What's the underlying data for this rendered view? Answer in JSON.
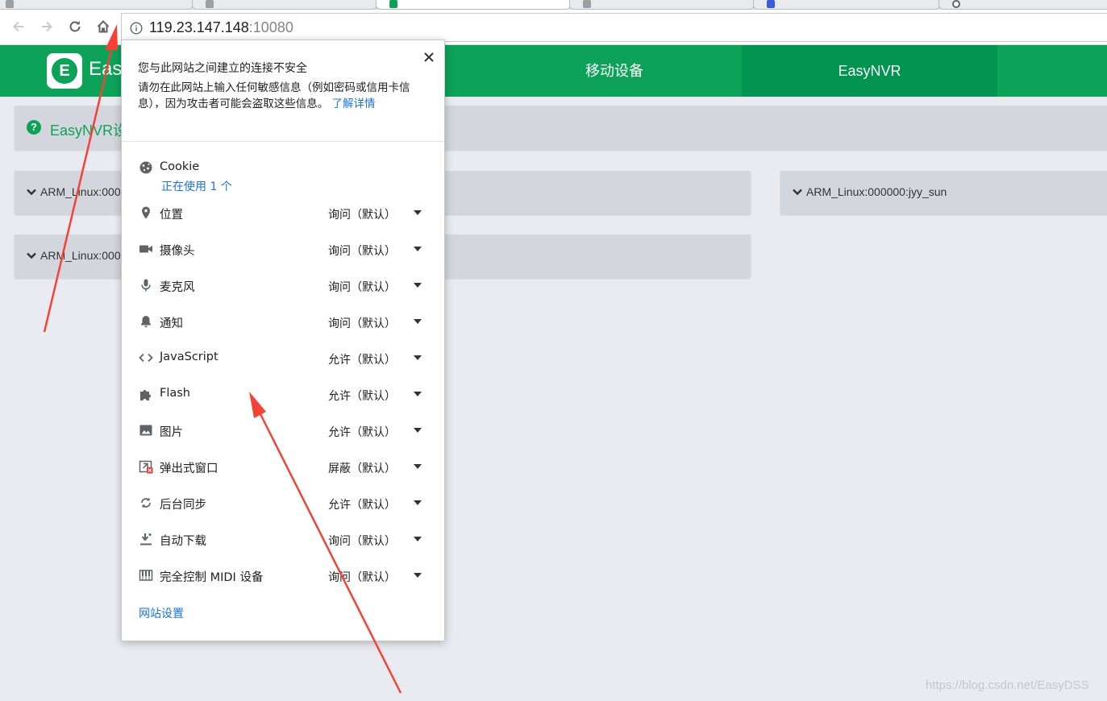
{
  "browser": {
    "url_host": "119.23.147.148",
    "url_port": ":10080"
  },
  "app": {
    "brand": "Eas",
    "logo_letter": "E",
    "nav": [
      {
        "label": "移动设备"
      },
      {
        "label": "EasyNVR"
      }
    ],
    "notice_text": "EasyNVR设",
    "devices": [
      {
        "label": "ARM_Linux:000"
      },
      {
        "label": "ARM_Linux:000"
      },
      {
        "label": "ARM_Linux:000000:jyy_sun"
      }
    ]
  },
  "popup": {
    "warning_title": "您与此网站之间建立的连接不安全",
    "warning_body": "请勿在此网站上输入任何敏感信息（例如密码或信用卡信息），因为攻击者可能会盗取这些信息。",
    "learn_more": "了解详情",
    "cookie": {
      "label": "Cookie",
      "in_use": "正在使用 1 个"
    },
    "permissions": [
      {
        "label": "位置",
        "value": "询问（默认）",
        "icon": "location-pin-icon"
      },
      {
        "label": "摄像头",
        "value": "询问（默认）",
        "icon": "camera-icon"
      },
      {
        "label": "麦克风",
        "value": "询问（默认）",
        "icon": "microphone-icon"
      },
      {
        "label": "通知",
        "value": "询问（默认）",
        "icon": "bell-icon"
      },
      {
        "label": "JavaScript",
        "value": "允许（默认）",
        "icon": "code-brackets-icon"
      },
      {
        "label": "Flash",
        "value": "允许（默认）",
        "icon": "puzzle-piece-icon"
      },
      {
        "label": "图片",
        "value": "允许（默认）",
        "icon": "image-icon"
      },
      {
        "label": "弹出式窗口",
        "value": "屏蔽（默认）",
        "icon": "popup-blocked-icon"
      },
      {
        "label": "后台同步",
        "value": "允许（默认）",
        "icon": "sync-icon"
      },
      {
        "label": "自动下载",
        "value": "询问（默认）",
        "icon": "download-icon"
      },
      {
        "label": "完全控制 MIDI 设备",
        "value": "询问（默认）",
        "icon": "piano-keys-icon"
      }
    ],
    "site_settings": "网站设置"
  },
  "watermark": "https://blog.csdn.net/EasyDSS",
  "colors": {
    "brand_green": "#0ca358",
    "brand_green_dark": "#009450",
    "link_blue": "#1a73e8",
    "annotation_red": "#f44336"
  }
}
